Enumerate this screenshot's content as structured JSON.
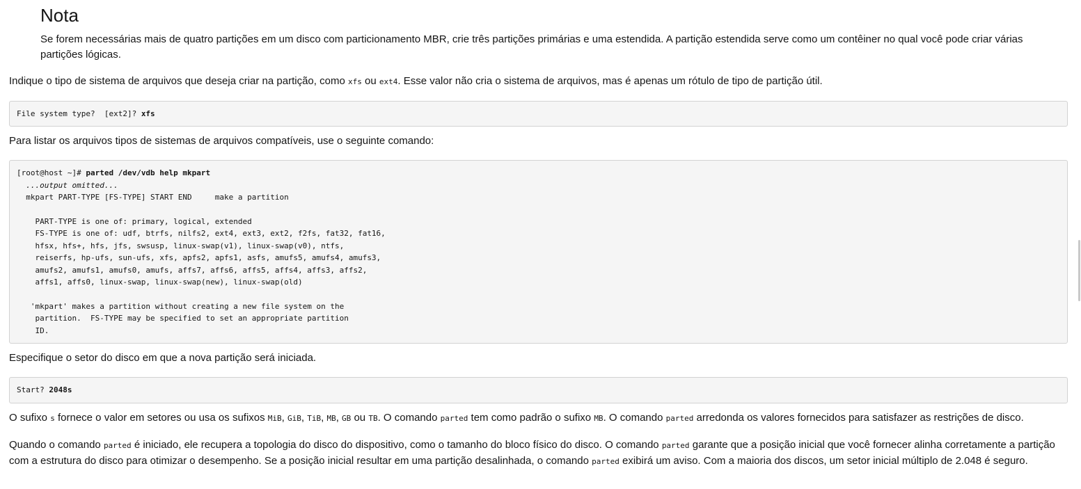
{
  "note": {
    "title": "Nota",
    "text": "Se forem necessárias mais de quatro partições em um disco com particionamento MBR, crie três partições primárias e uma estendida. A partição estendida serve como um contêiner no qual você pode criar várias partições lógicas."
  },
  "p1": {
    "a": "Indique o tipo de sistema de arquivos que deseja criar na partição, como ",
    "code1": "xfs",
    "b": " ou ",
    "code2": "ext4",
    "c": ". Esse valor não cria o sistema de arquivos, mas é apenas um rótulo de tipo de partição útil."
  },
  "code1": {
    "prompt": "File system type?  [ext2]? ",
    "input": "xfs"
  },
  "p2": "Para listar os arquivos tipos de sistemas de arquivos compatíveis, use o seguinte comando:",
  "code2": {
    "prompt": "[root@host ~]# ",
    "command": "parted /dev/vdb help mkpart",
    "omitted": "  ...output omitted...",
    "body": "  mkpart PART-TYPE [FS-TYPE] START END     make a partition\n\n    PART-TYPE is one of: primary, logical, extended\n    FS-TYPE is one of: udf, btrfs, nilfs2, ext4, ext3, ext2, f2fs, fat32, fat16,\n    hfsx, hfs+, hfs, jfs, swsusp, linux-swap(v1), linux-swap(v0), ntfs,\n    reiserfs, hp-ufs, sun-ufs, xfs, apfs2, apfs1, asfs, amufs5, amufs4, amufs3,\n    amufs2, amufs1, amufs0, amufs, affs7, affs6, affs5, affs4, affs3, affs2,\n    affs1, affs0, linux-swap, linux-swap(new), linux-swap(old)\n\n   'mkpart' makes a partition without creating a new file system on the\n    partition.  FS-TYPE may be specified to set an appropriate partition\n    ID."
  },
  "p3": "Especifique o setor do disco em que a nova partição será iniciada.",
  "code3": {
    "prompt": "Start? ",
    "input": "2048s"
  },
  "p4": {
    "a": "O sufixo ",
    "s": "s",
    "b": " fornece o valor em setores ou usa os sufixos ",
    "mib": "MiB",
    "c1": ", ",
    "gib": "GiB",
    "c2": ", ",
    "tib": "TiB",
    "c3": ", ",
    "mb": "MB",
    "c4": ", ",
    "gb": "GB",
    "c5": " ou ",
    "tb": "TB",
    "d": ". O comando ",
    "parted1": "parted",
    "e": " tem como padrão o sufixo ",
    "mb2": "MB",
    "f": ". O comando ",
    "parted2": "parted",
    "g": " arredonda os valores fornecidos para satisfazer as restrições de disco."
  },
  "p5": {
    "a": "Quando o comando ",
    "parted1": "parted",
    "b": " é iniciado, ele recupera a topologia do disco do dispositivo, como o tamanho do bloco físico do disco. O comando ",
    "parted2": "parted",
    "c": " garante que a posição inicial que você fornecer alinha corretamente a partição com a estrutura do disco para otimizar o desempenho. Se a posição inicial resultar em uma partição desalinhada, o comando ",
    "parted3": "parted",
    "d": " exibirá um aviso. Com a maioria dos discos, um setor inicial múltiplo de 2.048 é seguro."
  }
}
